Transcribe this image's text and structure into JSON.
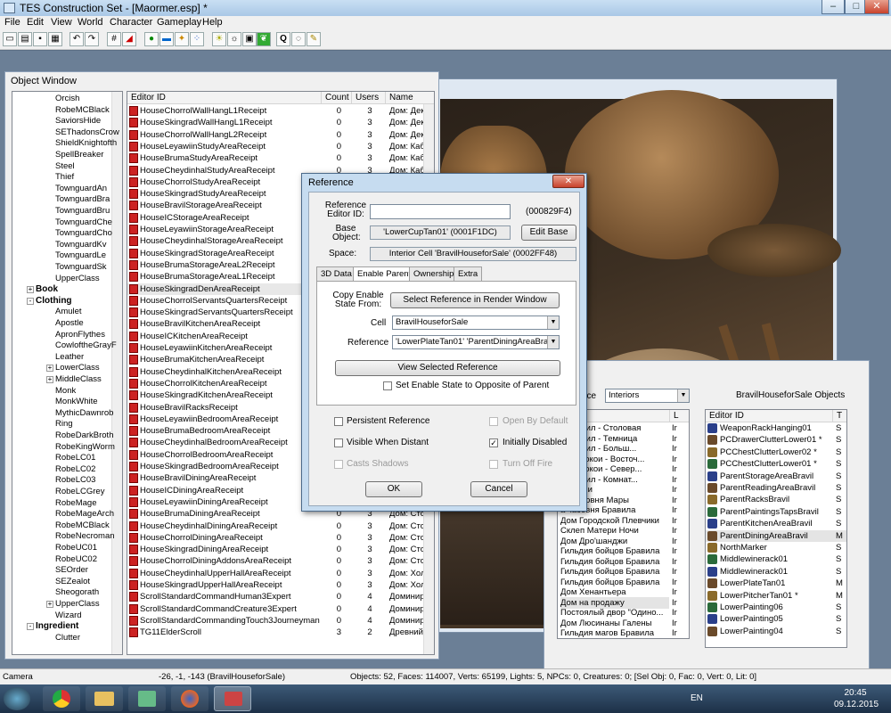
{
  "app": {
    "title": "TES Construction Set - [Maormer.esp] *"
  },
  "menu": [
    "File",
    "Edit",
    "View",
    "World",
    "Character",
    "Gameplay",
    "Help"
  ],
  "object_window": {
    "title": "Object Window",
    "tree": [
      {
        "label": "Orcish",
        "indent": 2
      },
      {
        "label": "RobeMCBlack",
        "indent": 2
      },
      {
        "label": "SaviorsHide",
        "indent": 2
      },
      {
        "label": "SEThadonsCrow",
        "indent": 2
      },
      {
        "label": "ShieldKnightofth",
        "indent": 2
      },
      {
        "label": "SpellBreaker",
        "indent": 2
      },
      {
        "label": "Steel",
        "indent": 2
      },
      {
        "label": "Thief",
        "indent": 2
      },
      {
        "label": "TownguardAn",
        "indent": 2
      },
      {
        "label": "TownguardBra",
        "indent": 2
      },
      {
        "label": "TownguardBru",
        "indent": 2
      },
      {
        "label": "TownguardChe",
        "indent": 2
      },
      {
        "label": "TownguardCho",
        "indent": 2
      },
      {
        "label": "TownguardKv",
        "indent": 2
      },
      {
        "label": "TownguardLe",
        "indent": 2
      },
      {
        "label": "TownguardSk",
        "indent": 2
      },
      {
        "label": "UpperClass",
        "indent": 2
      },
      {
        "label": "Book",
        "indent": 1,
        "bold": true,
        "exp": "+"
      },
      {
        "label": "Clothing",
        "indent": 1,
        "bold": true,
        "exp": "-"
      },
      {
        "label": "Amulet",
        "indent": 2
      },
      {
        "label": "Apostle",
        "indent": 2
      },
      {
        "label": "ApronFlythes",
        "indent": 2
      },
      {
        "label": "CowloftheGrayF",
        "indent": 2
      },
      {
        "label": "Leather",
        "indent": 2
      },
      {
        "label": "LowerClass",
        "indent": 2,
        "exp": "+"
      },
      {
        "label": "MiddleClass",
        "indent": 2,
        "exp": "+"
      },
      {
        "label": "Monk",
        "indent": 2
      },
      {
        "label": "MonkWhite",
        "indent": 2
      },
      {
        "label": "MythicDawnrob",
        "indent": 2
      },
      {
        "label": "Ring",
        "indent": 2
      },
      {
        "label": "RobeDarkBroth",
        "indent": 2
      },
      {
        "label": "RobeKingWorm",
        "indent": 2
      },
      {
        "label": "RobeLC01",
        "indent": 2
      },
      {
        "label": "RobeLC02",
        "indent": 2
      },
      {
        "label": "RobeLC03",
        "indent": 2
      },
      {
        "label": "RobeLCGrey",
        "indent": 2
      },
      {
        "label": "RobeMage",
        "indent": 2
      },
      {
        "label": "RobeMageArch",
        "indent": 2
      },
      {
        "label": "RobeMCBlack",
        "indent": 2
      },
      {
        "label": "RobeNecroman",
        "indent": 2
      },
      {
        "label": "RobeUC01",
        "indent": 2
      },
      {
        "label": "RobeUC02",
        "indent": 2
      },
      {
        "label": "SEOrder",
        "indent": 2
      },
      {
        "label": "SEZealot",
        "indent": 2
      },
      {
        "label": "Sheogorath",
        "indent": 2
      },
      {
        "label": "UpperClass",
        "indent": 2,
        "exp": "+"
      },
      {
        "label": "Wizard",
        "indent": 2
      },
      {
        "label": "Ingredient",
        "indent": 1,
        "bold": true,
        "exp": "-"
      },
      {
        "label": "Clutter",
        "indent": 2
      }
    ],
    "columns": [
      "Editor ID",
      "Count",
      "Users",
      "Name"
    ],
    "rows": [
      [
        "HouseChorrolWallHangL1Receipt",
        "0",
        "3",
        "Дом: Дек"
      ],
      [
        "HouseSkingradWallHangL1Receipt",
        "0",
        "3",
        "Дом: Дек"
      ],
      [
        "HouseChorrolWallHangL2Receipt",
        "0",
        "3",
        "Дом: Дек"
      ],
      [
        "HouseLeyawiinStudyAreaReceipt",
        "0",
        "3",
        "Дом: Каб"
      ],
      [
        "HouseBrumaStudyAreaReceipt",
        "0",
        "3",
        "Дом: Каб"
      ],
      [
        "HouseCheydinhalStudyAreaReceipt",
        "0",
        "3",
        "Дом: Каб"
      ],
      [
        "HouseChorrolStudyAreaReceipt",
        "0",
        "3",
        ""
      ],
      [
        "HouseSkingradStudyAreaReceipt",
        "0",
        "3",
        ""
      ],
      [
        "HouseBravilStorageAreaReceipt",
        "0",
        "3",
        ""
      ],
      [
        "HouseICStorageAreaReceipt",
        "",
        "",
        ""
      ],
      [
        "HouseLeyawiinStorageAreaReceipt",
        "",
        "",
        ""
      ],
      [
        "HouseCheydinhalStorageAreaReceipt",
        "",
        "",
        ""
      ],
      [
        "HouseSkingradStorageAreaReceipt",
        "",
        "",
        ""
      ],
      [
        "HouseBrumaStorageAreaL2Receipt",
        "",
        "",
        ""
      ],
      [
        "HouseBrumaStorageAreaL1Receipt",
        "",
        "",
        ""
      ],
      [
        "HouseSkingradDenAreaReceipt",
        "",
        "",
        ""
      ],
      [
        "HouseChorrolServantsQuartersReceipt",
        "",
        "",
        ""
      ],
      [
        "HouseSkingradServantsQuartersReceipt",
        "",
        "",
        ""
      ],
      [
        "HouseBravilKitchenAreaReceipt",
        "",
        "",
        ""
      ],
      [
        "HouseICKitchenAreaReceipt",
        "",
        "",
        ""
      ],
      [
        "HouseLeyawiinKitchenAreaReceipt",
        "",
        "",
        ""
      ],
      [
        "HouseBrumaKitchenAreaReceipt",
        "",
        "",
        ""
      ],
      [
        "HouseCheydinhalKitchenAreaReceipt",
        "",
        "",
        ""
      ],
      [
        "HouseChorrolKitchenAreaReceipt",
        "",
        "",
        ""
      ],
      [
        "HouseSkingradKitchenAreaReceipt",
        "",
        "",
        ""
      ],
      [
        "HouseBravilRacksReceipt",
        "",
        "",
        ""
      ],
      [
        "HouseLeyawiinBedroomAreaReceipt",
        "",
        "",
        ""
      ],
      [
        "HouseBrumaBedroomAreaReceipt",
        "",
        "",
        ""
      ],
      [
        "HouseCheydinhalBedroomAreaReceipt",
        "",
        "",
        ""
      ],
      [
        "HouseChorrolBedroomAreaReceipt",
        "",
        "",
        ""
      ],
      [
        "HouseSkingradBedroomAreaReceipt",
        "",
        "",
        ""
      ],
      [
        "HouseBravilDiningAreaReceipt",
        "",
        "",
        ""
      ],
      [
        "HouseICDiningAreaReceipt",
        "",
        "",
        ""
      ],
      [
        "HouseLeyawiinDiningAreaReceipt",
        "",
        "",
        ""
      ],
      [
        "HouseBrumaDiningAreaReceipt",
        "0",
        "3",
        "Дом: Стол"
      ],
      [
        "HouseCheydinhalDiningAreaReceipt",
        "0",
        "3",
        "Дом: Стол"
      ],
      [
        "HouseChorrolDiningAreaReceipt",
        "0",
        "3",
        "Дом: Стол"
      ],
      [
        "HouseSkingradDiningAreaReceipt",
        "0",
        "3",
        "Дом: Стол"
      ],
      [
        "HouseChorrolDiningAddonsAreaReceipt",
        "0",
        "3",
        "Дом: Стол"
      ],
      [
        "HouseCheydinhalUpperHallAreaReceipt",
        "0",
        "3",
        "Дом: Холл"
      ],
      [
        "HouseSkingradUpperHallAreaReceipt",
        "0",
        "3",
        "Дом: Холл"
      ],
      [
        "ScrollStandardCommandHuman3Expert",
        "0",
        "4",
        "Доминир"
      ],
      [
        "ScrollStandardCommandCreature3Expert",
        "0",
        "4",
        "Доминир"
      ],
      [
        "ScrollStandardCommandingTouch3Journeyman",
        "0",
        "4",
        "Доминир"
      ],
      [
        "TG11ElderScroll",
        "3",
        "2",
        "Древний"
      ]
    ]
  },
  "cell_view": {
    "space_label": "ace",
    "space_value": "Interiors",
    "objects_title": "BravilHouseforSale Objects",
    "cells_col2": "L",
    "cells": [
      "к Бравил - Столовая",
      "к Бравил - Темница",
      "к Бравил - Больш...",
      "ские покои - Восточ...",
      "ские покои - Север...",
      "к Бравил - Комнат...",
      "часовни",
      "ая часовня Мары",
      "а часовня Бравила",
      "Дом Городской Плевчики",
      "Склеп Матери Ночи",
      "Дом Дро'шанджи",
      "Гильдия бойцов Бравила",
      "Гильдия бойцов Бравила",
      "Гильдия бойцов Бравила",
      "Гильдия бойцов Бравила",
      "Дом Хенантьера",
      "Дом на продажу",
      "Постоялый двор \"Одино...",
      "Дом Люсинаны Галены",
      "Гильдия магов Бравила"
    ],
    "obj_columns": [
      "Editor ID",
      "T"
    ],
    "objects": [
      [
        "WeaponRackHanging01",
        "S"
      ],
      [
        "PCDrawerClutterLower01 *",
        "S"
      ],
      [
        "PCChestClutterLower02 *",
        "S"
      ],
      [
        "PCChestClutterLower01 *",
        "S"
      ],
      [
        "ParentStorageAreaBravil",
        "S"
      ],
      [
        "ParentReadingAreaBravil",
        "S"
      ],
      [
        "ParentRacksBravil",
        "S"
      ],
      [
        "ParentPaintingsTapsBravil",
        "S"
      ],
      [
        "ParentKitchenAreaBravil",
        "S"
      ],
      [
        "ParentDiningAreaBravil",
        "M"
      ],
      [
        "NorthMarker",
        "S"
      ],
      [
        "Middlewinerack01",
        "S"
      ],
      [
        "Middlewinerack01",
        "S"
      ],
      [
        "LowerPlateTan01",
        "M"
      ],
      [
        "LowerPitcherTan01 *",
        "M"
      ],
      [
        "LowerPainting06",
        "S"
      ],
      [
        "LowerPainting05",
        "S"
      ],
      [
        "LowerPainting04",
        "S"
      ]
    ]
  },
  "reference": {
    "title": "Reference",
    "editor_id_label": "Reference Editor ID:",
    "editor_id_value": "",
    "form_id": "(000829F4)",
    "base_label": "Base Object:",
    "base_value": "'LowerCupTan01' (0001F1DC)",
    "edit_base": "Edit Base",
    "space_label": "Space:",
    "space_value": "Interior Cell 'BravilHouseforSale' (0002FF48)",
    "tabs": [
      "3D Data",
      "Enable Parent",
      "Ownership",
      "Extra"
    ],
    "copy_label": "Copy Enable State From:",
    "select_ref_btn": "Select Reference in Render Window",
    "cell_label": "Cell",
    "cell_value": "BravilHouseforSale",
    "ref_label": "Reference",
    "ref_value": "'LowerPlateTan01' 'ParentDiningAreaBravil'",
    "view_selected": "View Selected Reference",
    "opposite_label": "Set Enable State to Opposite of Parent",
    "persistent": "Persistent Reference",
    "open_default": "Open By Default",
    "visible_distant": "Visible When Distant",
    "initially_disabled": "Initially Disabled",
    "casts_shadows": "Casts Shadows",
    "turn_off_fire": "Turn Off Fire",
    "ok": "OK",
    "cancel": "Cancel"
  },
  "status": {
    "mode": "Camera",
    "coords": "-26, -1, -143 (BravilHouseforSale)",
    "stats": "Objects: 52, Faces: 114007, Verts: 65199, Lights: 5, NPCs: 0, Creatures: 0; [Sel Obj: 0, Fac: 0, Vert: 0, Lit: 0]"
  },
  "taskbar": {
    "lang": "EN",
    "time": "20:45",
    "date": "09.12.2015"
  }
}
